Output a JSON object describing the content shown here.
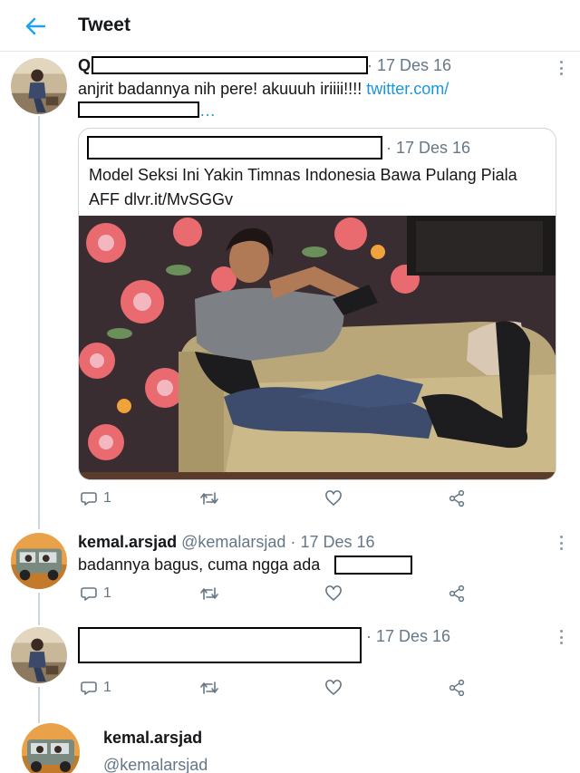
{
  "header": {
    "title": "Tweet"
  },
  "tweets": [
    {
      "name_start": "Q",
      "date": "17 Des 16",
      "text_line1": "anjrit badannya nih pere! akuuuh iriiii!!!! ",
      "link": "twitter.com/",
      "ellipsis": "…",
      "reply_count": "1",
      "quote": {
        "date": "17 Des 16",
        "text": "Model Seksi Ini Yakin Timnas Indonesia Bawa Pulang Piala AFF dlvr.it/MvSGGv"
      }
    },
    {
      "name": "kemal.arsjad",
      "handle": "@kemalarsjad",
      "date": "17 Des 16",
      "text": "badannya bagus, cuma ngga ada",
      "reply_count": "1"
    },
    {
      "date": "17 Des 16",
      "reply_count": "1"
    }
  ],
  "profile": {
    "name": "kemal.arsjad",
    "handle": "@kemalarsjad"
  },
  "separator": "·",
  "icons": {
    "back": "arrow-left-icon",
    "reply": "reply-icon",
    "retweet": "retweet-icon",
    "like": "heart-icon",
    "share": "share-icon",
    "more": "more-vertical-icon"
  },
  "colors": {
    "accent": "#1da1f2",
    "link": "#1b95e0",
    "muted": "#657786",
    "line": "#ccd6dd"
  }
}
